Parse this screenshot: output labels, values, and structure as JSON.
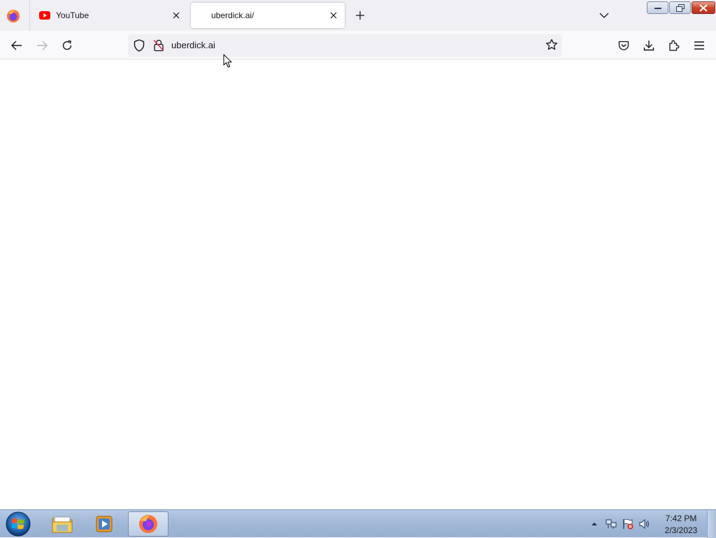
{
  "browser": {
    "tabs": [
      {
        "label": "YouTube",
        "favicon": "youtube-icon",
        "active": false
      },
      {
        "label": "uberdick.ai/",
        "favicon": "",
        "active": true
      }
    ],
    "address_bar": {
      "value": "uberdick.ai"
    }
  },
  "taskbar": {
    "clock_time": "7:42 PM",
    "clock_date": "2/3/2023",
    "pinned": [
      "windows-explorer-icon",
      "media-player-icon",
      "firefox-icon"
    ]
  },
  "colors": {
    "youtube_red": "#ff0000",
    "firefox_orange": "#ff7139",
    "firefox_purple": "#7542e5"
  }
}
